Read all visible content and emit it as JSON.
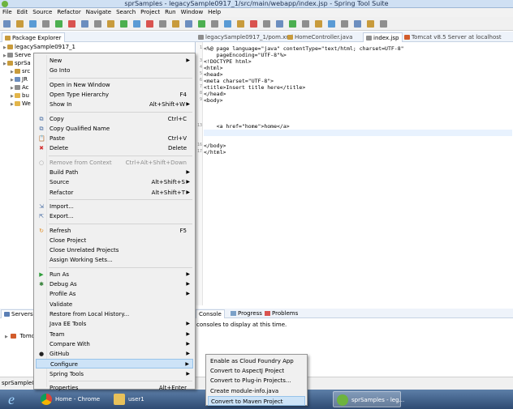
{
  "window": {
    "title": "sprSamples - legacySample0917_1/src/main/webapp/index.jsp - Spring Tool Suite"
  },
  "menubar": {
    "items": [
      "File",
      "Edit",
      "Source",
      "Refactor",
      "Navigate",
      "Search",
      "Project",
      "Run",
      "Window",
      "Help"
    ]
  },
  "package_explorer": {
    "tab_label": "Package Explorer",
    "tree": [
      {
        "label": "legacySample0917_1",
        "indent": 0
      },
      {
        "label": "Serve",
        "indent": 0
      },
      {
        "label": "sprSa",
        "indent": 0
      },
      {
        "label": "src",
        "indent": 1
      },
      {
        "label": "JR",
        "indent": 1
      },
      {
        "label": "Ac",
        "indent": 1
      },
      {
        "label": "bu",
        "indent": 1
      },
      {
        "label": "We",
        "indent": 1
      }
    ]
  },
  "editor": {
    "tabs": [
      "legacySample0917_1/pom.xml",
      "HomeController.java",
      "index.jsp",
      "Tomcat v8.5 Server at localhost"
    ],
    "code": [
      {
        "n": "1",
        "text": "<%@ page language=\"java\" contentType=\"text/html; charset=UTF-8\""
      },
      {
        "n": "",
        "text": "    pageEncoding=\"UTF-8\"%>"
      },
      {
        "n": "3",
        "text": "<!DOCTYPE html>"
      },
      {
        "n": "4",
        "text": "<html>"
      },
      {
        "n": "5",
        "text": "<head>"
      },
      {
        "n": "6",
        "text": "<meta charset=\"UTF-8\">"
      },
      {
        "n": "7",
        "text": "<title>Insert title here</title>"
      },
      {
        "n": "8",
        "text": "</head>"
      },
      {
        "n": "9",
        "text": "<body>"
      },
      {
        "n": "",
        "text": ""
      },
      {
        "n": "",
        "text": ""
      },
      {
        "n": "",
        "text": ""
      },
      {
        "n": "13",
        "text": "    <a href=\"home\">home</a>"
      },
      {
        "n": "",
        "text": ""
      },
      {
        "n": "",
        "text": ""
      },
      {
        "n": "16",
        "text": "</body>"
      },
      {
        "n": "17",
        "text": "</html>"
      }
    ]
  },
  "bottom_left": {
    "tab_label": "Servers",
    "item": "Tomc"
  },
  "console": {
    "tabs": [
      "Console",
      "Progress",
      "Problems"
    ],
    "message": "consoles to display at this time."
  },
  "context_menu": {
    "items": [
      {
        "label": "New",
        "shortcut": "",
        "submenu": true,
        "icon": ""
      },
      {
        "label": "Go Into",
        "shortcut": "",
        "submenu": false,
        "icon": ""
      },
      {
        "sep": true
      },
      {
        "label": "Open in New Window",
        "shortcut": "",
        "submenu": false,
        "icon": ""
      },
      {
        "label": "Open Type Hierarchy",
        "shortcut": "F4",
        "submenu": false,
        "icon": ""
      },
      {
        "label": "Show In",
        "shortcut": "Alt+Shift+W",
        "submenu": true,
        "icon": ""
      },
      {
        "sep": true
      },
      {
        "label": "Copy",
        "shortcut": "Ctrl+C",
        "submenu": false,
        "icon": "copy-icon"
      },
      {
        "label": "Copy Qualified Name",
        "shortcut": "",
        "submenu": false,
        "icon": "copy-qualified-icon"
      },
      {
        "label": "Paste",
        "shortcut": "Ctrl+V",
        "submenu": false,
        "icon": "paste-icon"
      },
      {
        "label": "Delete",
        "shortcut": "Delete",
        "submenu": false,
        "icon": "delete-icon"
      },
      {
        "sep": true
      },
      {
        "label": "Remove from Context",
        "shortcut": "Ctrl+Alt+Shift+Down",
        "submenu": false,
        "icon": "remove-context-icon",
        "disabled": true
      },
      {
        "label": "Build Path",
        "shortcut": "",
        "submenu": true,
        "icon": ""
      },
      {
        "label": "Source",
        "shortcut": "Alt+Shift+S",
        "submenu": true,
        "icon": ""
      },
      {
        "label": "Refactor",
        "shortcut": "Alt+Shift+T",
        "submenu": true,
        "icon": ""
      },
      {
        "sep": true
      },
      {
        "label": "Import...",
        "shortcut": "",
        "submenu": false,
        "icon": "import-icon"
      },
      {
        "label": "Export...",
        "shortcut": "",
        "submenu": false,
        "icon": "export-icon"
      },
      {
        "sep": true
      },
      {
        "label": "Refresh",
        "shortcut": "F5",
        "submenu": false,
        "icon": "refresh-icon"
      },
      {
        "label": "Close Project",
        "shortcut": "",
        "submenu": false,
        "icon": ""
      },
      {
        "label": "Close Unrelated Projects",
        "shortcut": "",
        "submenu": false,
        "icon": ""
      },
      {
        "label": "Assign Working Sets...",
        "shortcut": "",
        "submenu": false,
        "icon": ""
      },
      {
        "sep": true
      },
      {
        "label": "Run As",
        "shortcut": "",
        "submenu": true,
        "icon": "run-icon"
      },
      {
        "label": "Debug As",
        "shortcut": "",
        "submenu": true,
        "icon": "debug-icon"
      },
      {
        "label": "Profile As",
        "shortcut": "",
        "submenu": true,
        "icon": ""
      },
      {
        "label": "Validate",
        "shortcut": "",
        "submenu": false,
        "icon": ""
      },
      {
        "label": "Restore from Local History...",
        "shortcut": "",
        "submenu": false,
        "icon": ""
      },
      {
        "label": "Java EE Tools",
        "shortcut": "",
        "submenu": true,
        "icon": ""
      },
      {
        "label": "Team",
        "shortcut": "",
        "submenu": true,
        "icon": ""
      },
      {
        "label": "Compare With",
        "shortcut": "",
        "submenu": true,
        "icon": ""
      },
      {
        "label": "GitHub",
        "shortcut": "",
        "submenu": true,
        "icon": "github-icon"
      },
      {
        "label": "Configure",
        "shortcut": "",
        "submenu": true,
        "icon": "",
        "highlighted": true
      },
      {
        "label": "Spring Tools",
        "shortcut": "",
        "submenu": true,
        "icon": ""
      },
      {
        "sep": true
      },
      {
        "label": "Properties",
        "shortcut": "Alt+Enter",
        "submenu": false,
        "icon": ""
      }
    ]
  },
  "submenu": {
    "items": [
      {
        "label": "Enable as Cloud Foundry App"
      },
      {
        "label": "Convert to AspectJ Project"
      },
      {
        "label": "Convert to Plug-in Projects..."
      },
      {
        "label": "Create module-info.java"
      },
      {
        "label": "Convert to Maven Project",
        "highlighted": true
      }
    ]
  },
  "statusbar": {
    "text": "sprSample09"
  },
  "taskbar": {
    "buttons": [
      {
        "label": "Home - Chrome",
        "icon": "chrome-icon"
      },
      {
        "label": "user1",
        "icon": "folder-icon"
      },
      {
        "label": "sprSamples - leg...",
        "icon": "spring-icon"
      }
    ]
  },
  "colors": {
    "menu_highlight": "#cde3f7",
    "spring_green": "#6db33f",
    "taskbar": "#2e4a72"
  }
}
